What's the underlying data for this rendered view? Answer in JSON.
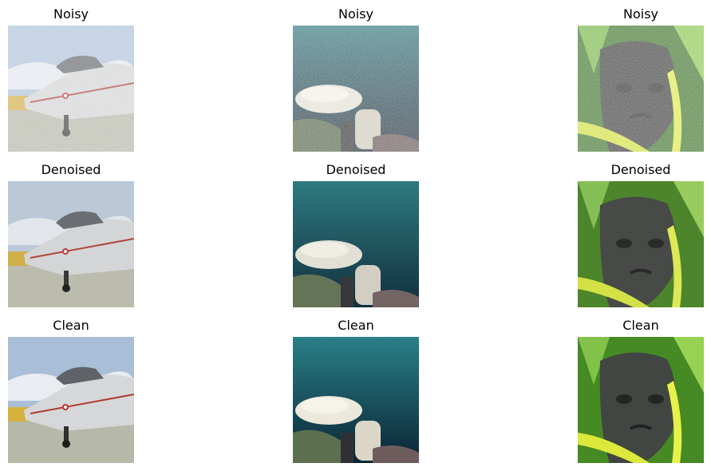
{
  "panels": [
    {
      "title": "Noisy",
      "image": "jet-aircraft-photo"
    },
    {
      "title": "Noisy",
      "image": "underwater-coral-photo"
    },
    {
      "title": "Noisy",
      "image": "stone-head-statue-photo"
    },
    {
      "title": "Denoised",
      "image": "jet-aircraft-photo"
    },
    {
      "title": "Denoised",
      "image": "underwater-coral-photo"
    },
    {
      "title": "Denoised",
      "image": "stone-head-statue-photo"
    },
    {
      "title": "Clean",
      "image": "jet-aircraft-photo"
    },
    {
      "title": "Clean",
      "image": "underwater-coral-photo"
    },
    {
      "title": "Clean",
      "image": "stone-head-statue-photo"
    }
  ]
}
